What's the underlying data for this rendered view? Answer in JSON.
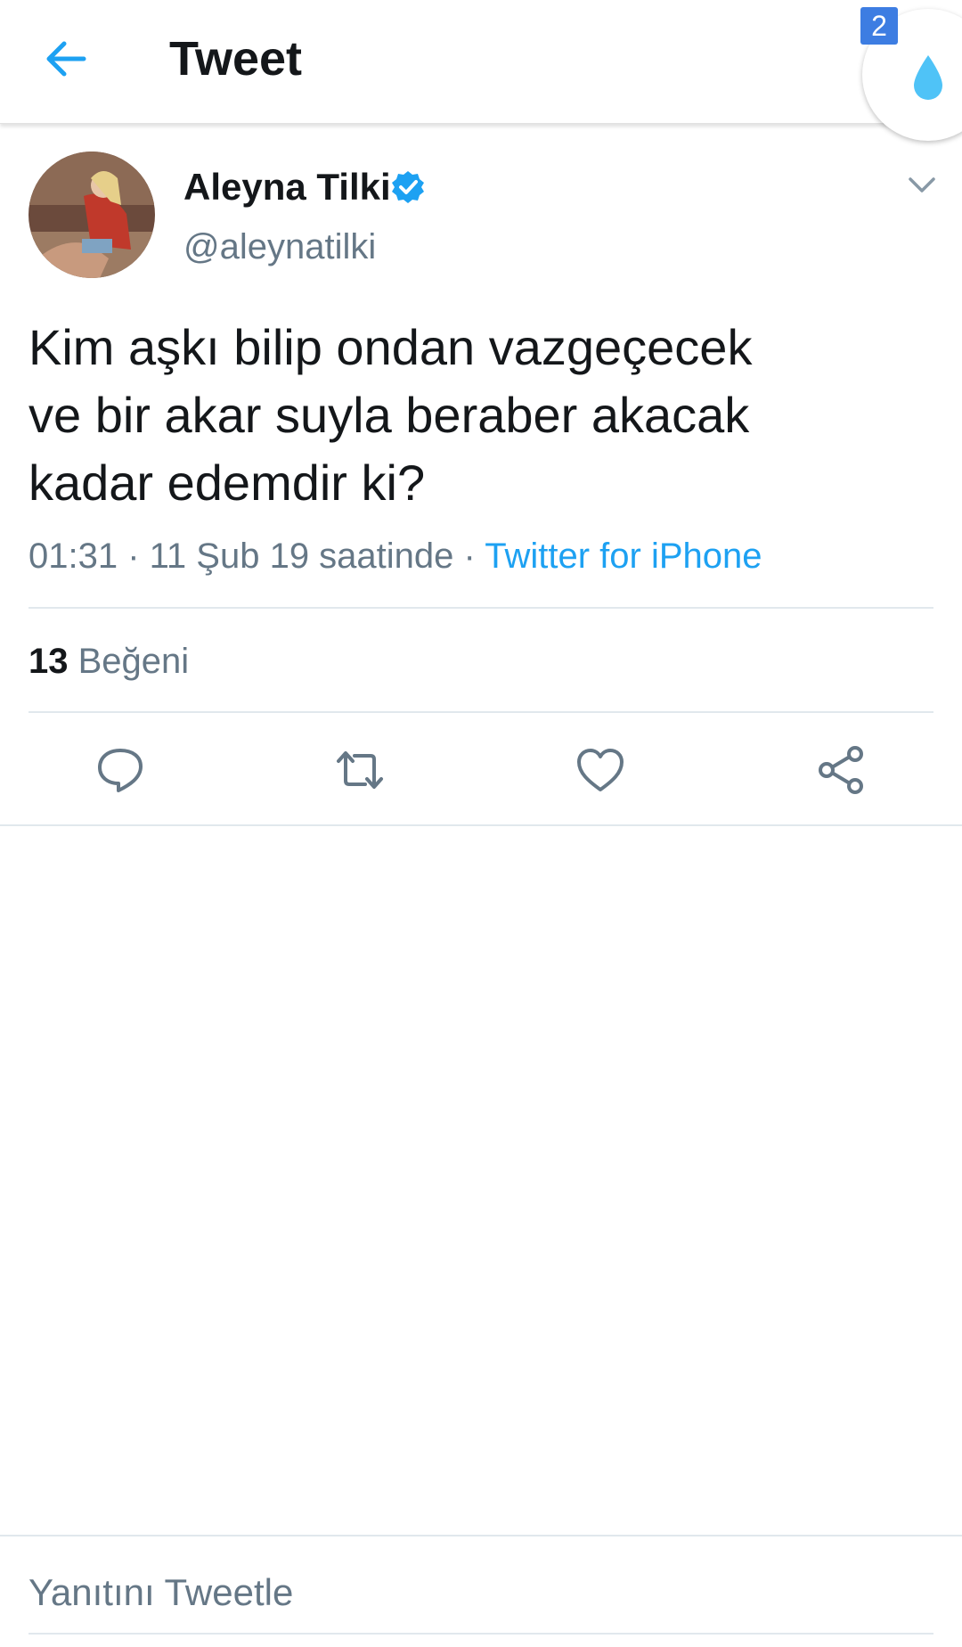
{
  "appbar": {
    "title": "Tweet",
    "badge_count": "2"
  },
  "tweet": {
    "author_name": "Aleyna Tilki",
    "handle": "@aleynatilki",
    "text": "Kim aşkı bilip ondan vazgeçecek\nve bir akar suyla beraber akacak\nkadar edemdir ki?",
    "time": "01:31",
    "date": "11 Şub 19 saatinde",
    "source": "Twitter for iPhone",
    "like_count": "13",
    "like_label": "Beğeni"
  },
  "reply": {
    "placeholder": "Yanıtını Tweetle"
  },
  "icons": {
    "back": "arrow-left-icon",
    "drop": "water-drop-icon",
    "verified": "verified-badge-icon",
    "caret": "chevron-down-icon",
    "reply": "speech-bubble-icon",
    "retweet": "retweet-icon",
    "like": "heart-icon",
    "share": "share-icon"
  },
  "colors": {
    "accent": "#1da1f2",
    "secondary_text": "#657786",
    "badge": "#3d7de2",
    "drop": "#4fc3f7"
  }
}
